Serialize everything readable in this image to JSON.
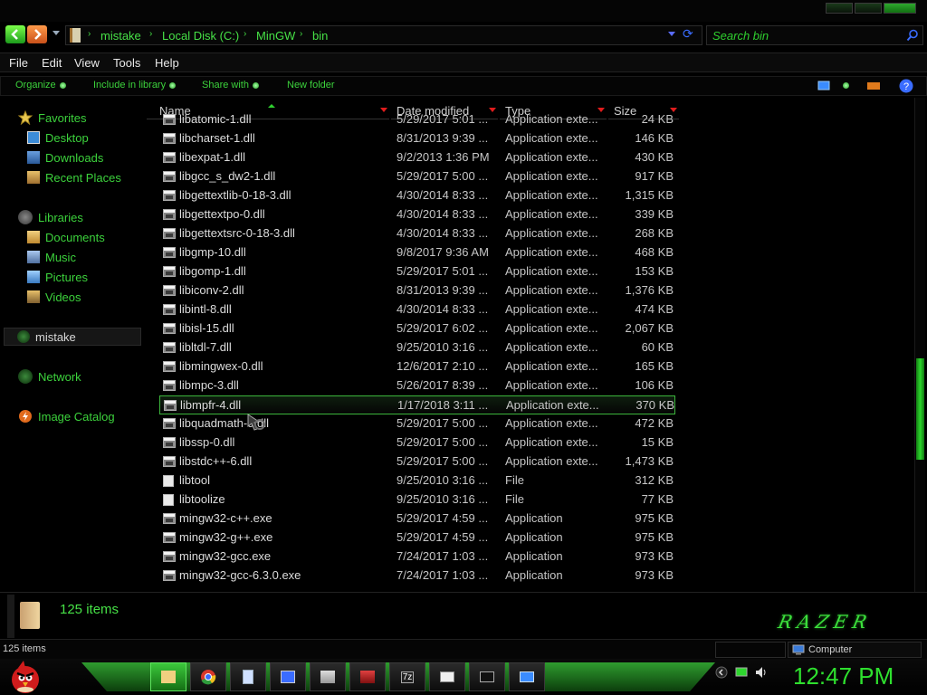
{
  "address": {
    "crumbs": [
      "mistake",
      "Local Disk (C:)",
      "MinGW",
      "bin"
    ]
  },
  "search": {
    "placeholder": "Search bin"
  },
  "menu": [
    "File",
    "Edit",
    "View",
    "Tools",
    "Help"
  ],
  "toolbar": {
    "organize": "Organize",
    "include_library": "Include in library",
    "share_with": "Share with",
    "new_folder": "New folder"
  },
  "nav": {
    "favorites": "Favorites",
    "desktop": "Desktop",
    "downloads": "Downloads",
    "recent": "Recent Places",
    "libraries": "Libraries",
    "documents": "Documents",
    "music": "Music",
    "pictures": "Pictures",
    "videos": "Videos",
    "homegroup": "mistake",
    "network": "Network",
    "image_catalog": "Image Catalog"
  },
  "columns": {
    "name": "Name",
    "date": "Date modified",
    "type": "Type",
    "size": "Size"
  },
  "files": [
    {
      "name": "libatomic-1.dll",
      "date": "5/29/2017 5:01 ...",
      "type": "Application exte...",
      "size": "24 KB",
      "icon": "app-icon"
    },
    {
      "name": "libcharset-1.dll",
      "date": "8/31/2013 9:39 ...",
      "type": "Application exte...",
      "size": "146 KB",
      "icon": "app-icon"
    },
    {
      "name": "libexpat-1.dll",
      "date": "9/2/2013 1:36 PM",
      "type": "Application exte...",
      "size": "430 KB",
      "icon": "app-icon"
    },
    {
      "name": "libgcc_s_dw2-1.dll",
      "date": "5/29/2017 5:00 ...",
      "type": "Application exte...",
      "size": "917 KB",
      "icon": "app-icon"
    },
    {
      "name": "libgettextlib-0-18-3.dll",
      "date": "4/30/2014 8:33 ...",
      "type": "Application exte...",
      "size": "1,315 KB",
      "icon": "app-icon"
    },
    {
      "name": "libgettextpo-0.dll",
      "date": "4/30/2014 8:33 ...",
      "type": "Application exte...",
      "size": "339 KB",
      "icon": "app-icon"
    },
    {
      "name": "libgettextsrc-0-18-3.dll",
      "date": "4/30/2014 8:33 ...",
      "type": "Application exte...",
      "size": "268 KB",
      "icon": "app-icon"
    },
    {
      "name": "libgmp-10.dll",
      "date": "9/8/2017 9:36 AM",
      "type": "Application exte...",
      "size": "468 KB",
      "icon": "app-icon"
    },
    {
      "name": "libgomp-1.dll",
      "date": "5/29/2017 5:01 ...",
      "type": "Application exte...",
      "size": "153 KB",
      "icon": "app-icon"
    },
    {
      "name": "libiconv-2.dll",
      "date": "8/31/2013 9:39 ...",
      "type": "Application exte...",
      "size": "1,376 KB",
      "icon": "app-icon"
    },
    {
      "name": "libintl-8.dll",
      "date": "4/30/2014 8:33 ...",
      "type": "Application exte...",
      "size": "474 KB",
      "icon": "app-icon"
    },
    {
      "name": "libisl-15.dll",
      "date": "5/29/2017 6:02 ...",
      "type": "Application exte...",
      "size": "2,067 KB",
      "icon": "app-icon"
    },
    {
      "name": "libltdl-7.dll",
      "date": "9/25/2010 3:16 ...",
      "type": "Application exte...",
      "size": "60 KB",
      "icon": "app-icon"
    },
    {
      "name": "libmingwex-0.dll",
      "date": "12/6/2017 2:10 ...",
      "type": "Application exte...",
      "size": "165 KB",
      "icon": "app-icon"
    },
    {
      "name": "libmpc-3.dll",
      "date": "5/26/2017 8:39 ...",
      "type": "Application exte...",
      "size": "106 KB",
      "icon": "app-icon"
    },
    {
      "name": "libmpfr-4.dll",
      "date": "1/17/2018 3:11 ...",
      "type": "Application exte...",
      "size": "370 KB",
      "icon": "app-icon"
    },
    {
      "name": "libquadmath-0.dll",
      "date": "5/29/2017 5:00 ...",
      "type": "Application exte...",
      "size": "472 KB",
      "icon": "app-icon"
    },
    {
      "name": "libssp-0.dll",
      "date": "5/29/2017 5:00 ...",
      "type": "Application exte...",
      "size": "15 KB",
      "icon": "app-icon"
    },
    {
      "name": "libstdc++-6.dll",
      "date": "5/29/2017 5:00 ...",
      "type": "Application exte...",
      "size": "1,473 KB",
      "icon": "app-icon"
    },
    {
      "name": "libtool",
      "date": "9/25/2010 3:16 ...",
      "type": "File",
      "size": "312 KB",
      "icon": "file-icon"
    },
    {
      "name": "libtoolize",
      "date": "9/25/2010 3:16 ...",
      "type": "File",
      "size": "77 KB",
      "icon": "file-icon"
    },
    {
      "name": "mingw32-c++.exe",
      "date": "5/29/2017 4:59 ...",
      "type": "Application",
      "size": "975 KB",
      "icon": "app-icon"
    },
    {
      "name": "mingw32-g++.exe",
      "date": "5/29/2017 4:59 ...",
      "type": "Application",
      "size": "975 KB",
      "icon": "app-icon"
    },
    {
      "name": "mingw32-gcc.exe",
      "date": "7/24/2017 1:03 ...",
      "type": "Application",
      "size": "973 KB",
      "icon": "app-icon"
    },
    {
      "name": "mingw32-gcc-6.3.0.exe",
      "date": "7/24/2017 1:03 ...",
      "type": "Application",
      "size": "973 KB",
      "icon": "app-icon"
    }
  ],
  "selected_index": 15,
  "details": {
    "count": "125 items",
    "logo": "RAZER"
  },
  "status": {
    "count": "125 items",
    "location": "Computer"
  },
  "taskbar": {
    "clock": "12:47 PM"
  },
  "colors": {
    "accent": "#3cd23c",
    "highlight_border": "#3cb43c",
    "sort_arrow": "#e01c1c"
  }
}
